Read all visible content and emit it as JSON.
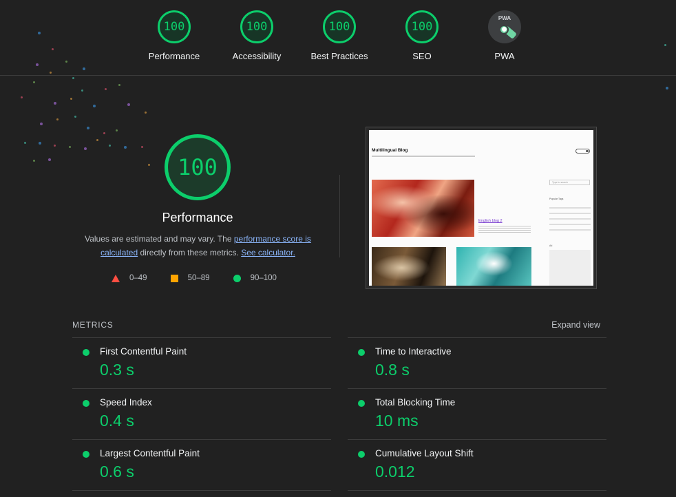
{
  "categories": [
    {
      "label": "Performance",
      "score": "100"
    },
    {
      "label": "Accessibility",
      "score": "100"
    },
    {
      "label": "Best Practices",
      "score": "100"
    },
    {
      "label": "SEO",
      "score": "100"
    },
    {
      "label": "PWA",
      "badge": "PWA"
    }
  ],
  "performance": {
    "score": "100",
    "title": "Performance",
    "desc_prefix": "Values are estimated and may vary. The ",
    "link_score": "performance score is calculated",
    "desc_middle": " directly from these metrics. ",
    "link_calc": "See calculator."
  },
  "legend": [
    {
      "range": "0–49",
      "color": "#ff4e42"
    },
    {
      "range": "50–89",
      "color": "#ffa400"
    },
    {
      "range": "90–100",
      "color": "#0cce6b"
    }
  ],
  "screenshot": {
    "blog_title": "Multilingual Blog",
    "post_link": "English blog 2",
    "search_placeholder": "Type to search",
    "tags_heading": "Popular Tags",
    "ad_label": "Ad"
  },
  "metrics": {
    "heading": "METRICS",
    "expand_label": "Expand view",
    "items": [
      {
        "name": "First Contentful Paint",
        "value": "0.3 s"
      },
      {
        "name": "Time to Interactive",
        "value": "0.8 s"
      },
      {
        "name": "Speed Index",
        "value": "0.4 s"
      },
      {
        "name": "Total Blocking Time",
        "value": "10 ms"
      },
      {
        "name": "Largest Contentful Paint",
        "value": "0.6 s"
      },
      {
        "name": "Cumulative Layout Shift",
        "value": "0.012"
      }
    ]
  },
  "colors": {
    "pass": "#0cce6b",
    "average": "#ffa400",
    "fail": "#ff4e42",
    "background": "#212121",
    "link": "#8ab4f8"
  }
}
